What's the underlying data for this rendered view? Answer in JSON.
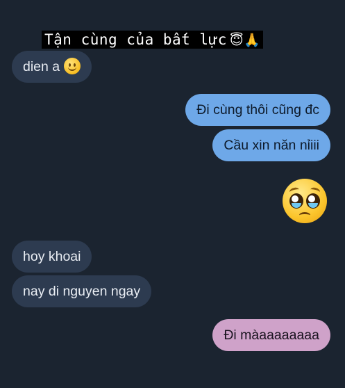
{
  "caption": {
    "text": "Tận cùng của bất lực",
    "emojis": "😇🙏"
  },
  "messages": [
    {
      "id": "m1",
      "side": "incoming",
      "text": "dien a",
      "emoji": "slightly-smiling-face"
    },
    {
      "id": "m2",
      "side": "outgoing",
      "text": "Đi cùng thôi cũng đc"
    },
    {
      "id": "m3",
      "side": "outgoing",
      "text": "Cầu xin năn nỉiii"
    },
    {
      "id": "m4",
      "side": "outgoing",
      "emoji": "pleading-face"
    },
    {
      "id": "m5",
      "side": "incoming",
      "text": "hoy khoai"
    },
    {
      "id": "m6",
      "side": "incoming",
      "text": "nay di nguyen ngay"
    },
    {
      "id": "m7",
      "side": "outgoing",
      "text": "Đi màaaaaaaaa"
    }
  ],
  "colors": {
    "background": "#1b2430",
    "incoming_bubble": "#2d3b50",
    "outgoing_bubble": "#6ea8e8",
    "outgoing_bubble_last": "#cfa2c9",
    "caption_bg": "#000000"
  }
}
